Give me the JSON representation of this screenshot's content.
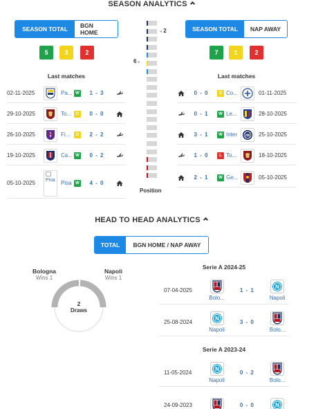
{
  "season": {
    "title": "SEASON ANALYTICS",
    "left_toggle": [
      "SEASON TOTAL",
      "BGN HOME"
    ],
    "right_toggle": [
      "SEASON TOTAL",
      "NAP AWAY"
    ],
    "left_form": {
      "w": "5",
      "d": "3",
      "l": "2"
    },
    "right_form": {
      "w": "7",
      "d": "1",
      "l": "2"
    },
    "last_matches_label": "Last matches",
    "position_label": "Position",
    "pos_top": "2",
    "pos_mid": "6",
    "left_matches": [
      {
        "date": "02-11-2025",
        "team": "Pa...",
        "res": "W",
        "score": "1 - 3",
        "venue": "away",
        "crest": "parma"
      },
      {
        "date": "29-10-2025",
        "team": "To...",
        "res": "D",
        "score": "0 - 0",
        "venue": "home",
        "crest": "torino"
      },
      {
        "date": "26-10-2025",
        "team": "Fi...",
        "res": "D",
        "score": "2 - 2",
        "venue": "away",
        "crest": "fiorentina"
      },
      {
        "date": "19-10-2025",
        "team": "Ca...",
        "res": "W",
        "score": "0 - 2",
        "venue": "away",
        "crest": "cagliari"
      },
      {
        "date": "05-10-2025",
        "team": "Pisa",
        "res": "W",
        "score": "4 - 0",
        "venue": "home",
        "crest": "pisa",
        "broken_img_text": "Pisa"
      }
    ],
    "right_matches": [
      {
        "date": "01-11-2025",
        "team": "Co...",
        "res": "D",
        "score": "0 - 0",
        "venue": "home",
        "crest": "como"
      },
      {
        "date": "28-10-2025",
        "team": "Le...",
        "res": "W",
        "score": "0 - 1",
        "venue": "away",
        "crest": "lecce"
      },
      {
        "date": "25-10-2025",
        "team": "Inter",
        "res": "W",
        "score": "3 - 1",
        "venue": "home",
        "crest": "inter"
      },
      {
        "date": "18-10-2025",
        "team": "To...",
        "res": "L",
        "score": "1 - 0",
        "venue": "away",
        "crest": "torino"
      },
      {
        "date": "05-10-2025",
        "team": "Ge...",
        "res": "W",
        "score": "2 - 1",
        "venue": "home",
        "crest": "genoa"
      }
    ]
  },
  "h2h": {
    "title": "HEAD TO HEAD ANALYTICS",
    "toggle": [
      "TOTAL",
      "BGN HOME / NAP AWAY"
    ],
    "home_team": "Bologna",
    "home_wins": "Wins 1",
    "away_team": "Napoli",
    "away_wins": "Wins 1",
    "draws_count": "2",
    "draws_label": "Draws",
    "seasons": [
      {
        "label": "Serie A 2024-25",
        "matches": [
          {
            "date": "07-04-2025",
            "home": "Bolo...",
            "score": "1 - 1",
            "away": "Napoli",
            "home_crest": "bologna",
            "away_crest": "napoli"
          },
          {
            "date": "25-08-2024",
            "home": "Napoli",
            "score": "3 - 0",
            "away": "Bolo...",
            "home_crest": "napoli",
            "away_crest": "bologna"
          }
        ]
      },
      {
        "label": "Serie A 2023-24",
        "matches": [
          {
            "date": "11-05-2024",
            "home": "Napoli",
            "score": "0 - 2",
            "away": "Bolo...",
            "home_crest": "napoli",
            "away_crest": "bologna"
          },
          {
            "date": "24-09-2023",
            "home": "",
            "score": "0 - 0",
            "away": "",
            "home_crest": "bologna",
            "away_crest": "napoli"
          }
        ]
      }
    ]
  },
  "colors": {
    "accent": "#1e88e5",
    "win": "#1fa34a",
    "draw": "#f2d51c",
    "loss": "#e03131",
    "link": "#3a6fb0"
  }
}
